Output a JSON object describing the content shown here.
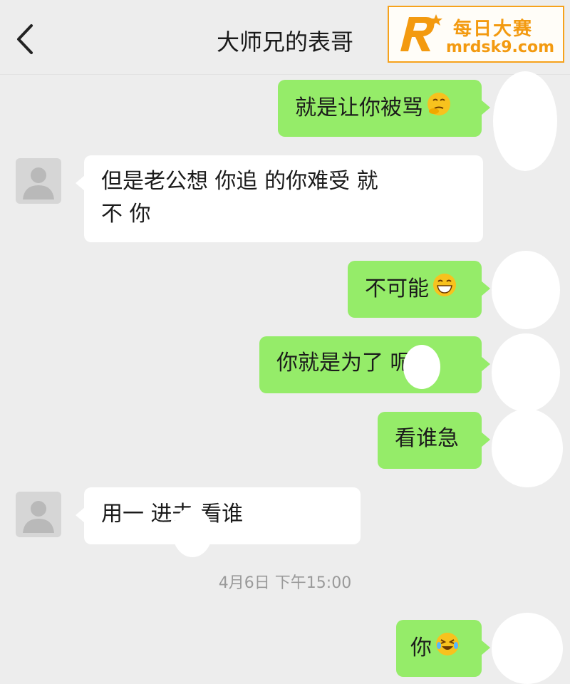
{
  "header": {
    "title": "大师兄的表哥",
    "back_icon": "chevron-left-icon",
    "more_label": "···"
  },
  "watermark": {
    "name": "每日大赛",
    "url": "mrdsk9.com",
    "color": "#f39a10"
  },
  "colors": {
    "sent_bubble": "#95ec69",
    "received_bubble": "#ffffff",
    "background": "#ededed"
  },
  "messages": [
    {
      "side": "right",
      "text": "就是让你被骂",
      "emoji": "thinking-face-icon"
    },
    {
      "side": "left",
      "line1": "但是老公想 你追 的你难受 就",
      "line2": "不 你"
    },
    {
      "side": "right",
      "text": "不可能",
      "emoji": "grinning-face-icon"
    },
    {
      "side": "right",
      "text": "你就是为了 呢"
    },
    {
      "side": "right",
      "text": "看谁急"
    },
    {
      "side": "left",
      "text": "用一 进去 看谁"
    },
    {
      "side": "right",
      "text": "你",
      "emoji": "crying-laughing-face-icon"
    }
  ],
  "timestamp": "4月6日 下午15:00"
}
